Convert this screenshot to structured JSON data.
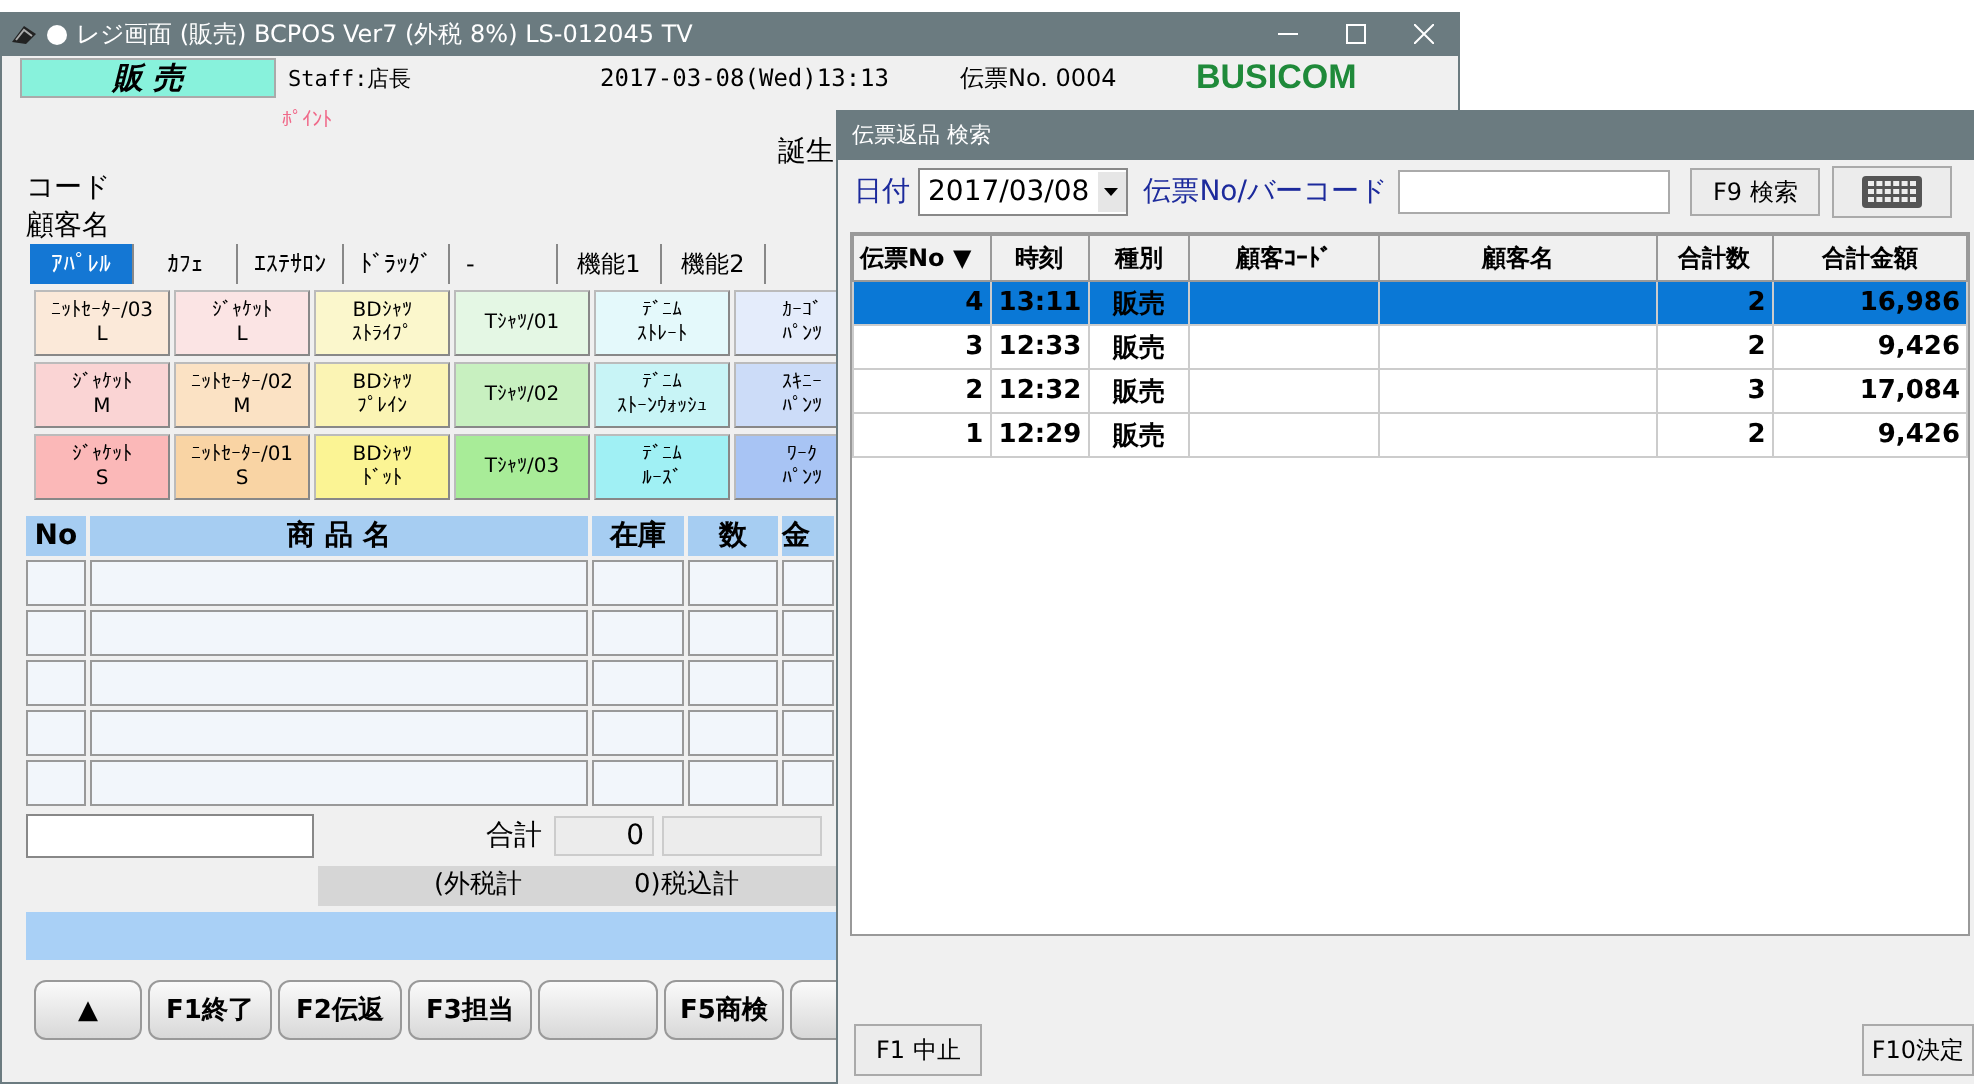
{
  "main_window": {
    "title": "レジ画面 (販売) BCPOS Ver7 (外税 8%) LS-012045 TV",
    "mode": "販 売",
    "staff": "Staff:店長",
    "datetime": "2017-03-08(Wed)13:13",
    "slip_no": "伝票No. 0004",
    "logo": "BUSICOM",
    "point_label": "ﾎﾟｲﾝﾄ",
    "birthday_label": "誕生",
    "customer_labels": [
      "コード",
      "顧客名"
    ],
    "tabs": [
      {
        "label": "ｱﾊﾟﾚﾙ",
        "selected": true
      },
      {
        "label": "ｶﾌｪ",
        "selected": false
      },
      {
        "label": "ｴｽﾃｻﾛﾝ",
        "selected": false
      },
      {
        "label": "ﾄﾞﾗｯｸﾞ",
        "selected": false
      },
      {
        "label": "-",
        "selected": false
      },
      {
        "label": "機能1",
        "selected": false
      },
      {
        "label": "機能2",
        "selected": false
      }
    ],
    "products": [
      {
        "lines": [
          "ﾆｯﾄｾｰﾀｰ/03",
          "L"
        ],
        "color": "#fbe9d9"
      },
      {
        "lines": [
          "ｼﾞｬｹｯﾄ",
          "L"
        ],
        "color": "#fbe4e4"
      },
      {
        "lines": [
          "BDｼｬﾂ",
          "ｽﾄﾗｲﾌﾟ"
        ],
        "color": "#fbf7cc"
      },
      {
        "lines": [
          "Tｼｬﾂ/01"
        ],
        "color": "#e4f7e4"
      },
      {
        "lines": [
          "ﾃﾞﾆﾑ",
          "ｽﾄﾚｰﾄ"
        ],
        "color": "#e4f9fb"
      },
      {
        "lines": [
          "ｶｰｺﾞ",
          "ﾊﾟﾝﾂ"
        ],
        "color": "#e4ecfb"
      },
      {
        "lines": [
          "ｼﾞｬｹｯﾄ",
          "M"
        ],
        "color": "#fad4d4"
      },
      {
        "lines": [
          "ﾆｯﾄｾｰﾀｰ/02",
          "M"
        ],
        "color": "#fbe2c4"
      },
      {
        "lines": [
          "BDｼｬﾂ",
          "ﾌﾟﾚｲﾝ"
        ],
        "color": "#fbf4b4"
      },
      {
        "lines": [
          "Tｼｬﾂ/02"
        ],
        "color": "#c8f0c0"
      },
      {
        "lines": [
          "ﾃﾞﾆﾑ",
          "ｽﾄｰﾝｳｫｯｼｭ"
        ],
        "color": "#c8f4f6"
      },
      {
        "lines": [
          "ｽｷﾆｰ",
          "ﾊﾟﾝﾂ"
        ],
        "color": "#ccdcf8"
      },
      {
        "lines": [
          "ｼﾞｬｹｯﾄ",
          "S"
        ],
        "color": "#fbb8b8"
      },
      {
        "lines": [
          "ﾆｯﾄｾｰﾀｰ/01",
          "S"
        ],
        "color": "#f9d4a4"
      },
      {
        "lines": [
          "BDｼｬﾂ",
          "ﾄﾞｯﾄ"
        ],
        "color": "#fbf494"
      },
      {
        "lines": [
          "Tｼｬﾂ/03"
        ],
        "color": "#a8ec98"
      },
      {
        "lines": [
          "ﾃﾞﾆﾑ",
          "ﾙｰｽﾞ"
        ],
        "color": "#a0f0f4"
      },
      {
        "lines": [
          "ﾜｰｸ",
          "ﾊﾟﾝﾂ"
        ],
        "color": "#a8c4f4"
      }
    ],
    "sales_table": {
      "columns": [
        "No",
        "商 品 名",
        "在庫",
        "数",
        "金"
      ]
    },
    "total_label": "合計",
    "total_value": "0",
    "tax_excluded_label": "(外税計",
    "tax_included_label": "0)税込計",
    "function_keys": [
      {
        "kind": "key",
        "label": "▲"
      },
      {
        "kind": "key",
        "label": "F1終了"
      },
      {
        "kind": "key",
        "label": "F2伝返"
      },
      {
        "kind": "key",
        "label": "F3担当"
      },
      {
        "kind": "blank"
      },
      {
        "kind": "key",
        "label": "F5商検"
      },
      {
        "kind": "blank"
      }
    ]
  },
  "dialog": {
    "title": "伝票返品 検索",
    "date_label": "日付",
    "date_value": "2017/03/08",
    "slip_label": "伝票No/バーコード",
    "search_button": "F9 検索",
    "table": {
      "columns": [
        "伝票No ▼",
        "時刻",
        "種別",
        "顧客ｺｰﾄﾞ",
        "顧客名",
        "合計数",
        "合計金額"
      ],
      "rows": [
        {
          "selected": true,
          "cells": [
            "4",
            "13:11",
            "販売",
            "",
            "",
            "2",
            "16,986"
          ]
        },
        {
          "selected": false,
          "cells": [
            "3",
            "12:33",
            "販売",
            "",
            "",
            "2",
            "9,426"
          ]
        },
        {
          "selected": false,
          "cells": [
            "2",
            "12:32",
            "販売",
            "",
            "",
            "3",
            "17,084"
          ]
        },
        {
          "selected": false,
          "cells": [
            "1",
            "12:29",
            "販売",
            "",
            "",
            "2",
            "9,426"
          ]
        }
      ]
    },
    "cancel_button": "F1 中止",
    "confirm_button": "F10決定"
  }
}
